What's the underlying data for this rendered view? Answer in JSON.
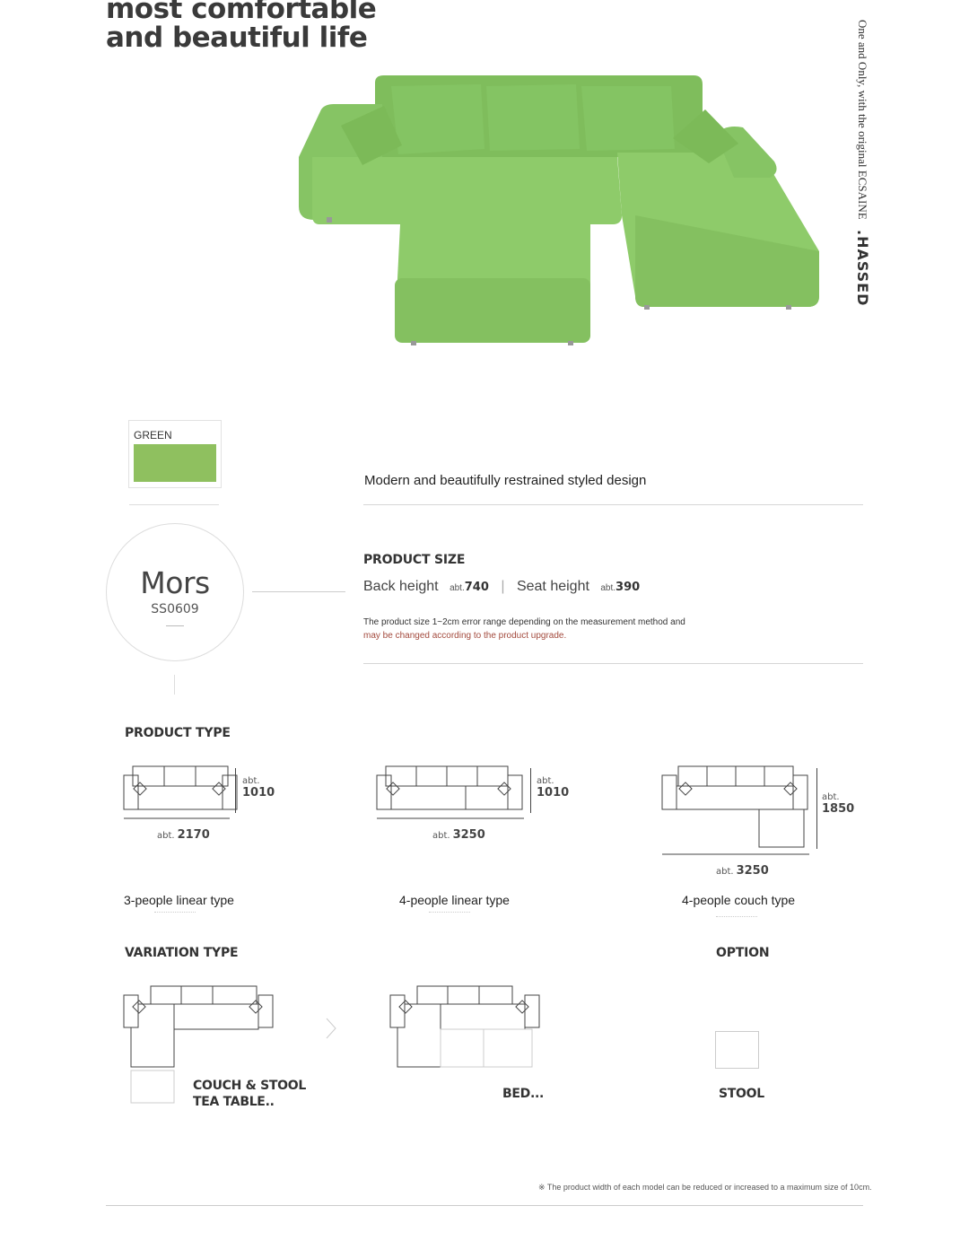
{
  "header": {
    "headline_line1": "most comfortable",
    "headline_line2": "and beautiful life",
    "side_text": "One and Only, with the original ECSAINE",
    "side_brand": ".HASSED"
  },
  "hero": {
    "product_color": "#8ecb6a"
  },
  "color_option": {
    "label": "GREEN",
    "swatch_color": "#8fc05f"
  },
  "tagline": "Modern and beautifully restrained styled design",
  "product": {
    "name": "Mors",
    "code": "SS0609"
  },
  "product_size": {
    "title": "PRODUCT SIZE",
    "back_label": "Back height",
    "back_abt": "abt.",
    "back_value": "740",
    "seat_label": "Seat height",
    "seat_abt": "abt.",
    "seat_value": "390",
    "note_line1": "The product size 1~2cm error range depending on the measurement method and",
    "note_line2": "may be changed according to the product upgrade."
  },
  "product_type": {
    "title": "PRODUCT TYPE",
    "items": [
      {
        "label": "3-people linear type",
        "width_abt": "abt.",
        "width": "2170",
        "depth_abt": "abt.",
        "depth": "1010"
      },
      {
        "label": "4-people linear type",
        "width_abt": "abt.",
        "width": "3250",
        "depth_abt": "abt.",
        "depth": "1010"
      },
      {
        "label": "4-people couch type",
        "width_abt": "abt.",
        "width": "3250",
        "depth_abt": "abt.",
        "depth": "1850"
      }
    ]
  },
  "variation_type": {
    "title": "VARIATION TYPE",
    "items": [
      {
        "label_line1": "COUCH & STOOL",
        "label_line2": "TEA TABLE.."
      },
      {
        "label_line1": "BED...",
        "label_line2": ""
      }
    ]
  },
  "option": {
    "title": "OPTION",
    "item_label": "STOOL"
  },
  "footnote": "※ The product width of each model can be reduced or increased to a maximum size of 10cm."
}
